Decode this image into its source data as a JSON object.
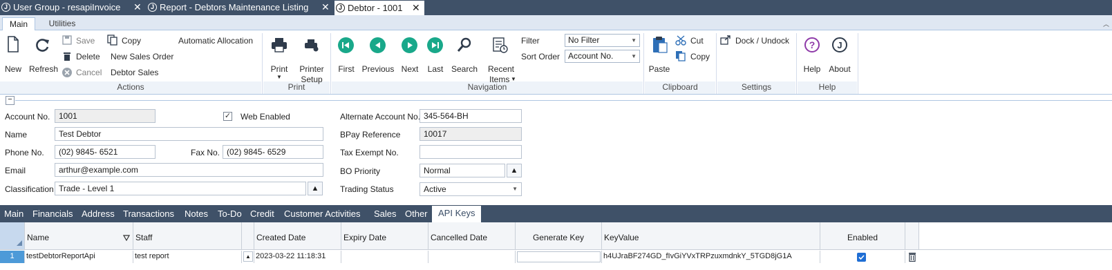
{
  "doc_tabs": [
    {
      "icon": "J",
      "label": "User Group - resapiInvoice",
      "close": "✕"
    },
    {
      "icon": "J",
      "label": "Report - Debtors Maintenance Listing",
      "close": "✕"
    },
    {
      "icon": "J",
      "label": "Debtor - 1001",
      "close": "✕"
    }
  ],
  "ribbon_tabs": [
    "Main",
    "Utilities"
  ],
  "ribbon": {
    "actions": {
      "new": "New",
      "refresh": "Refresh",
      "save": "Save",
      "delete": "Delete",
      "cancel": "Cancel",
      "copy": "Copy",
      "new_sales_order": "New Sales Order",
      "debtor_sales": "Debtor Sales",
      "automatic_allocation": "Automatic Allocation",
      "group": "Actions"
    },
    "print": {
      "print": "Print",
      "printer_setup_1": "Printer",
      "printer_setup_2": "Setup",
      "group": "Print"
    },
    "navigation": {
      "first": "First",
      "previous": "Previous",
      "next": "Next",
      "last": "Last",
      "search": "Search",
      "recent_1": "Recent",
      "recent_2": "Items",
      "filter_label": "Filter",
      "filter_value": "No Filter",
      "sort_label": "Sort Order",
      "sort_value": "Account No.",
      "group": "Navigation"
    },
    "clipboard": {
      "paste": "Paste",
      "cut": "Cut",
      "copy": "Copy",
      "group": "Clipboard"
    },
    "settings": {
      "dock": "Dock / Undock",
      "group": "Settings"
    },
    "help": {
      "help": "Help",
      "about": "About",
      "group": "Help"
    }
  },
  "form": {
    "account_no_label": "Account No.",
    "account_no": "1001",
    "web_enabled_label": "Web Enabled",
    "web_enabled": true,
    "name_label": "Name",
    "name": "Test Debtor",
    "phone_label": "Phone No.",
    "phone": "(02) 9845- 6521",
    "fax_label": "Fax No.",
    "fax": "(02) 9845- 6529",
    "email_label": "Email",
    "email": "arthur@example.com",
    "classification_label": "Classification",
    "classification": "Trade - Level 1",
    "alt_account_label": "Alternate Account No.",
    "alt_account": "345-564-BH",
    "bpay_label": "BPay Reference",
    "bpay": "10017",
    "tax_exempt_label": "Tax Exempt No.",
    "tax_exempt": "",
    "bo_priority_label": "BO Priority",
    "bo_priority": "Normal",
    "trading_status_label": "Trading Status",
    "trading_status": "Active"
  },
  "bottom_tabs": [
    "Main",
    "Financials",
    "Address",
    "Transactions",
    "Notes",
    "To-Do",
    "Credit",
    "Customer Activities",
    "Sales",
    "Other",
    "API Keys"
  ],
  "grid": {
    "headers": {
      "name": "Name",
      "staff": "Staff",
      "created": "Created Date",
      "expiry": "Expiry Date",
      "cancelled": "Cancelled Date",
      "generate": "Generate Key",
      "key": "KeyValue",
      "enabled": "Enabled"
    },
    "row": {
      "num": "1",
      "name": "testDebtorReportApi",
      "staff": "test report",
      "created": "2023-03-22 11:18:31",
      "expiry": "",
      "cancelled": "",
      "generate": "",
      "key": "h4UJraBF274GD_fIvGiYVxTRPzuxmdnkY_5TGD8jG1A",
      "enabled": true
    }
  },
  "colors": {
    "nav_green": "#19a88a",
    "tab_bar": "#3f5168",
    "help_purple": "#8e3aa8"
  }
}
